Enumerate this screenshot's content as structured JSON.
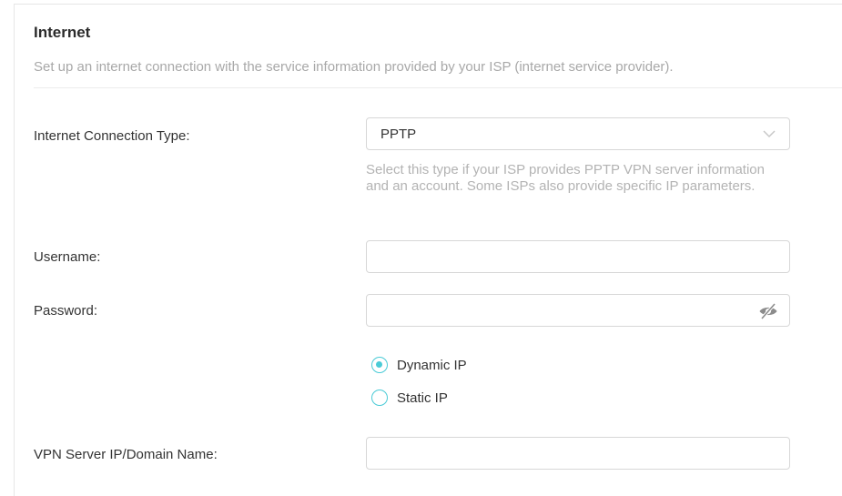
{
  "section": {
    "title": "Internet",
    "subtitle": "Set up an internet connection with the service information provided by your ISP (internet service provider)."
  },
  "connection_type": {
    "label": "Internet Connection Type:",
    "value": "PPTP",
    "help": "Select this type if your ISP provides PPTP VPN server information and an account. Some ISPs also provide specific IP parameters."
  },
  "username": {
    "label": "Username:",
    "value": ""
  },
  "password": {
    "label": "Password:",
    "value": ""
  },
  "ip_mode": {
    "options": [
      {
        "label": "Dynamic IP",
        "checked": true
      },
      {
        "label": "Static IP",
        "checked": false
      }
    ]
  },
  "vpn_server": {
    "label": "VPN Server IP/Domain Name:",
    "value": ""
  },
  "colors": {
    "accent": "#4acbd6",
    "border": "#d7d7d7",
    "muted_text": "#b3b3b3"
  },
  "icons": {
    "dropdown": "chevron-down-icon",
    "password_toggle": "eye-slash-icon"
  }
}
